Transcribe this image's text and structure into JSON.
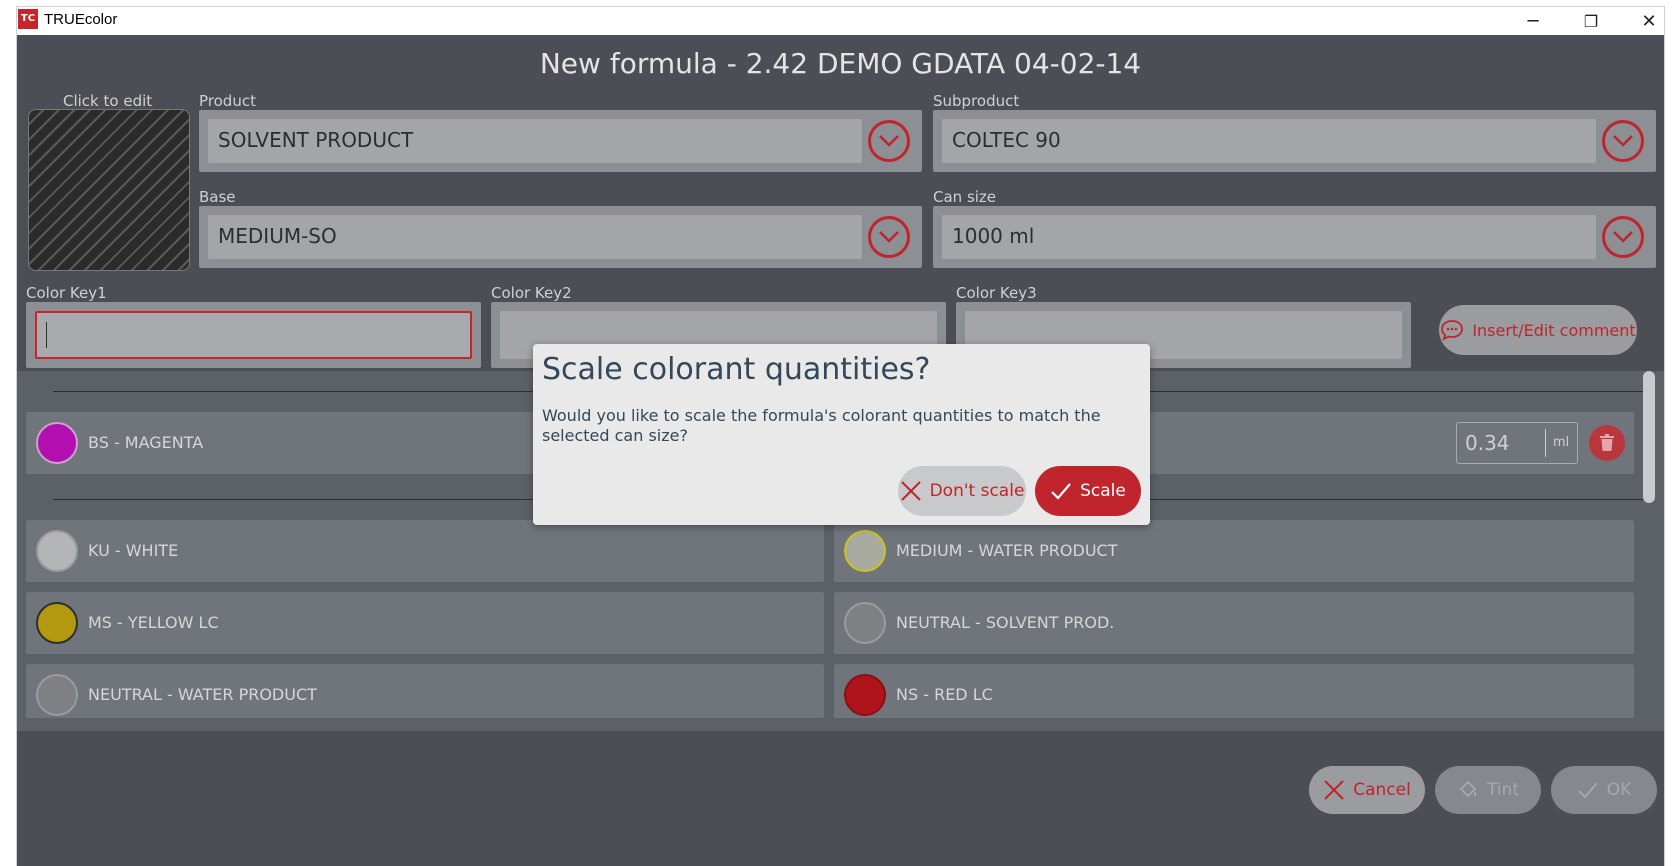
{
  "window": {
    "app_icon_text": "TC",
    "title": "TRUEcolor",
    "minimize_label": "─",
    "restore_label": "❐",
    "close_label": "✕"
  },
  "header": {
    "title": "New formula - 2.42  DEMO GDATA 04-02-14"
  },
  "swatch": {
    "label": "Click to edit"
  },
  "fields": {
    "product": {
      "label": "Product",
      "value": "SOLVENT PRODUCT"
    },
    "subproduct": {
      "label": "Subproduct",
      "value": "COLTEC 90"
    },
    "base": {
      "label": "Base",
      "value": "MEDIUM-SO"
    },
    "can_size": {
      "label": "Can size",
      "value": "1000 ml"
    }
  },
  "color_keys": {
    "key1_label": "Color Key1",
    "key2_label": "Color Key2",
    "key3_label": "Color Key3",
    "key1_value": "",
    "key2_value": "",
    "key3_value": ""
  },
  "comment_button": {
    "label": "Insert/Edit comment"
  },
  "selected_colorants": [
    {
      "name": "BS - MAGENTA",
      "color": "#b30fb0",
      "quantity": "0.34",
      "unit": "ml"
    }
  ],
  "available_colorants": [
    {
      "name": "KU - WHITE",
      "color": "#b4b5b7"
    },
    {
      "name": "MEDIUM - WATER PRODUCT",
      "color": "#a9aaa0",
      "border": "#c9c21f"
    },
    {
      "name": "MS - YELLOW LC",
      "color": "#b29910"
    },
    {
      "name": "NEUTRAL - SOLVENT PROD.",
      "color": "#7e8083"
    },
    {
      "name": "NEUTRAL - WATER PRODUCT",
      "color": "#7e8083"
    },
    {
      "name": "NS - RED LC",
      "color": "#b0141b"
    }
  ],
  "footer": {
    "cancel_label": "Cancel",
    "tint_label": "Tint",
    "ok_label": "OK"
  },
  "dialog": {
    "title": "Scale colorant quantities?",
    "message": "Would you like to scale the formula's colorant quantities to match the selected can size?",
    "dont_scale_label": "Don't scale",
    "scale_label": "Scale"
  },
  "colors": {
    "accent": "#c0252d",
    "background": "#4b4f55",
    "dialog_text": "#34485a"
  }
}
